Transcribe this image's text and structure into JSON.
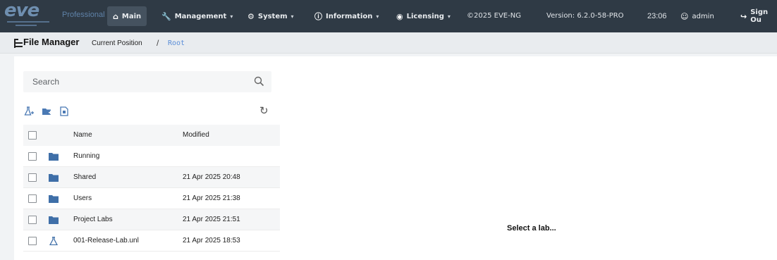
{
  "navbar": {
    "logo_text": "eve",
    "edition": "Professional",
    "items": [
      {
        "label": "Main",
        "icon": "home-icon",
        "active": true
      },
      {
        "label": "Management",
        "icon": "wrench-icon"
      },
      {
        "label": "System",
        "icon": "gear-icon"
      },
      {
        "label": "Information",
        "icon": "info-icon"
      },
      {
        "label": "Licensing",
        "icon": "license-icon"
      }
    ],
    "copyright": "©2025 EVE-NG",
    "version": "Version: 6.2.0-58-PRO",
    "time": "23:06",
    "user": "admin",
    "sign_out": "Sign Ou"
  },
  "breadcrumb": {
    "title": "File Manager",
    "current_position_label": "Current Position",
    "separator": "/",
    "root": "Root"
  },
  "file_manager": {
    "search_placeholder": "Search",
    "toolbar": {
      "icons": [
        "add-lab-icon",
        "add-folder-icon",
        "import-icon",
        "refresh-icon"
      ]
    },
    "columns": {
      "name": "Name",
      "modified": "Modified"
    },
    "rows": [
      {
        "type": "folder",
        "name": "Running",
        "modified": ""
      },
      {
        "type": "folder",
        "name": "Shared",
        "modified": "21 Apr 2025 20:48"
      },
      {
        "type": "folder",
        "name": "Users",
        "modified": "21 Apr 2025 21:38"
      },
      {
        "type": "folder",
        "name": "Project Labs",
        "modified": "21 Apr 2025 21:51"
      },
      {
        "type": "lab",
        "name": "001-Release-Lab.unl",
        "modified": "21 Apr 2025 18:53"
      }
    ]
  },
  "preview": {
    "placeholder": "Select a lab..."
  },
  "colors": {
    "navbar_bg": "#2f3a45",
    "accent_blue": "#5a8ed8",
    "folder_icon": "#3f6fa8"
  }
}
